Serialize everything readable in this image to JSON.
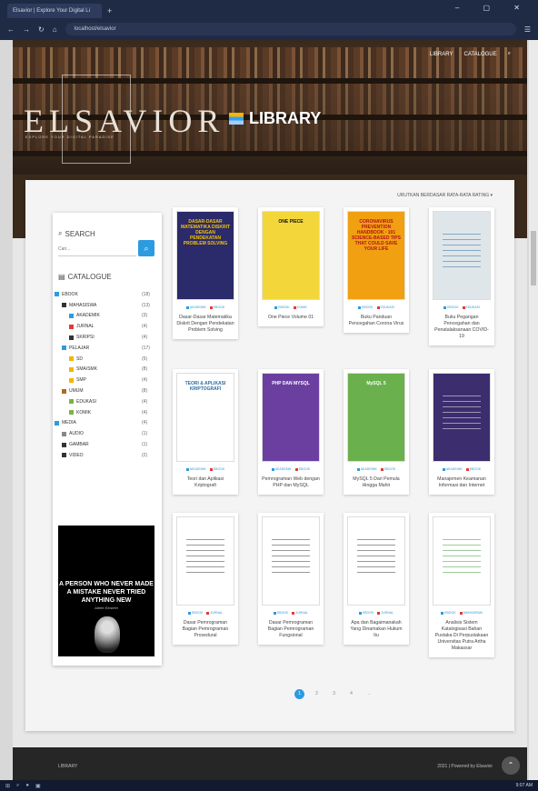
{
  "browser": {
    "tab_title": "Elsavior | Explore Your Digital Li",
    "new_tab": "+",
    "url": "localhost/elsavior",
    "window_controls": "–  ▢  ✕"
  },
  "hero": {
    "nav_library": "LIBRARY",
    "nav_catalogue": "CATALOGUE",
    "logo": "ELSAVIOR",
    "logo_sub": "EXPLORE YOUR DIGITAL PARADISE",
    "title": "LIBRARY"
  },
  "sort_label": "URUTKAN BERDASAR RATA-RATA RATING ▾",
  "sidebar": {
    "search_title": "SEARCH",
    "search_placeholder": "Cari...",
    "catalogue_title": "CATALOGUE",
    "items": [
      {
        "label": "EBOOK",
        "count": "(18)",
        "level": 0,
        "color": "#2d9be0"
      },
      {
        "label": "MAHASISWA",
        "count": "(13)",
        "level": 1,
        "color": "#333333"
      },
      {
        "label": "AKADEMIK",
        "count": "(3)",
        "level": 2,
        "color": "#2d9be0"
      },
      {
        "label": "JURNAL",
        "count": "(4)",
        "level": 2,
        "color": "#e53935"
      },
      {
        "label": "SKRIPSI",
        "count": "(4)",
        "level": 2,
        "color": "#333333"
      },
      {
        "label": "PELAJAR",
        "count": "(17)",
        "level": 1,
        "color": "#2d9be0"
      },
      {
        "label": "SD",
        "count": "(5)",
        "level": 2,
        "color": "#f5b400"
      },
      {
        "label": "SMA/SMK",
        "count": "(8)",
        "level": 2,
        "color": "#f5b400"
      },
      {
        "label": "SMP",
        "count": "(4)",
        "level": 2,
        "color": "#f5b400"
      },
      {
        "label": "UMUM",
        "count": "(8)",
        "level": 1,
        "color": "#b06a1e"
      },
      {
        "label": "EDUKASI",
        "count": "(4)",
        "level": 2,
        "color": "#7cb342"
      },
      {
        "label": "KOMIK",
        "count": "(4)",
        "level": 2,
        "color": "#7cb342"
      },
      {
        "label": "MEDIA",
        "count": "(4)",
        "level": 0,
        "color": "#2d9be0"
      },
      {
        "label": "AUDIO",
        "count": "(1)",
        "level": 1,
        "color": "#888888"
      },
      {
        "label": "GAMBAR",
        "count": "(1)",
        "level": 1,
        "color": "#333333"
      },
      {
        "label": "VIDEO",
        "count": "(2)",
        "level": 1,
        "color": "#333333"
      }
    ],
    "quote": "A PERSON WHO NEVER MADE A MISTAKE NEVER TRIED ANYTHING NEW",
    "quote_author": "Albert Einstein"
  },
  "books": [
    {
      "title": "Dasar-Dasar Matematika Diskrit Dengan Pendekatan Problem Solving",
      "cover_text": "DASAR-DASAR MATEMATIKA DISKRIT DENGAN PENDEKATAN PROBLEM SOLVING",
      "tags": [
        "AKADEMIK",
        "EBOOK"
      ],
      "cover_bg": "#2b2a6b",
      "cover_fg": "#f5c400"
    },
    {
      "title": "One Piece Volume 01",
      "cover_text": "ONE PIECE",
      "tags": [
        "EBOOK",
        "KOMIK"
      ],
      "cover_bg": "#f3d73a",
      "cover_fg": "#111111"
    },
    {
      "title": "Buku Panduan Pencegahan Corona Virus",
      "cover_text": "CORONAVIRUS PREVENTION HANDBOOK · 101 SCIENCE-BASED TIPS THAT COULD SAVE YOUR LIFE",
      "tags": [
        "EBOOK",
        "EDUKASI"
      ],
      "cover_bg": "#f0a010",
      "cover_fg": "#b3121c"
    },
    {
      "title": "Buku Pegangan Pencegahan dan Penatalaksanaan COVID-19",
      "cover_text": "",
      "tags": [
        "EBOOK",
        "EDUKASI"
      ],
      "cover_bg": "#dfe6ea",
      "cover_fg": "#2d6a9f"
    },
    {
      "title": "Teori dan Aplikasi Kriptografi",
      "cover_text": "TEORI & APLIKASI KRIPTOGRAFI",
      "tags": [
        "AKADEMIK",
        "EBOOK"
      ],
      "cover_bg": "#ffffff",
      "cover_fg": "#2d6a9f"
    },
    {
      "title": "Pemrograman Web dengan PHP dan MySQL",
      "cover_text": "PHP DAN MYSQL",
      "tags": [
        "AKADEMIK",
        "EBOOK"
      ],
      "cover_bg": "#6b3fa0",
      "cover_fg": "#ffffff"
    },
    {
      "title": "MySQL 5 Dari Pemula Hingga Mahir",
      "cover_text": "MySQL 5",
      "tags": [
        "AKADEMIK",
        "EBOOK"
      ],
      "cover_bg": "#6ab04c",
      "cover_fg": "#ffffff"
    },
    {
      "title": "Manajemen Keamanan Informasi dan Internet",
      "cover_text": "",
      "tags": [
        "AKADEMIK",
        "EBOOK"
      ],
      "cover_bg": "#3b2d6e",
      "cover_fg": "#ffffff"
    },
    {
      "title": "Dasar Pemrograman Bagian Pemrograman Prosedural",
      "cover_text": "",
      "tags": [
        "EBOOK",
        "JURNAL"
      ],
      "cover_bg": "#ffffff",
      "cover_fg": "#333333"
    },
    {
      "title": "Dasar Pemrograman Bagian Pemrograman Fungsional",
      "cover_text": "",
      "tags": [
        "EBOOK",
        "JURNAL"
      ],
      "cover_bg": "#ffffff",
      "cover_fg": "#333333"
    },
    {
      "title": "Apa dan Bagaimanakah Yang Dinamakan Hukum Itu",
      "cover_text": "",
      "tags": [
        "EBOOK",
        "JURNAL"
      ],
      "cover_bg": "#ffffff",
      "cover_fg": "#333333"
    },
    {
      "title": "Analisis Sistem Katalogisasi Bahan Pustaka Di Perpustakaan Universitas Putra Artha Makassar",
      "cover_text": "",
      "tags": [
        "EBOOK",
        "MAHASISWA"
      ],
      "cover_bg": "#ffffff",
      "cover_fg": "#3a9a3a"
    }
  ],
  "pagination": [
    "1",
    "2",
    "3",
    "4",
    "→"
  ],
  "footer": {
    "left": "LIBRARY",
    "right": "2021 | Powered by Elsavior",
    "to_top": "⌃"
  },
  "taskbar": {
    "time": "9:07 AM"
  }
}
